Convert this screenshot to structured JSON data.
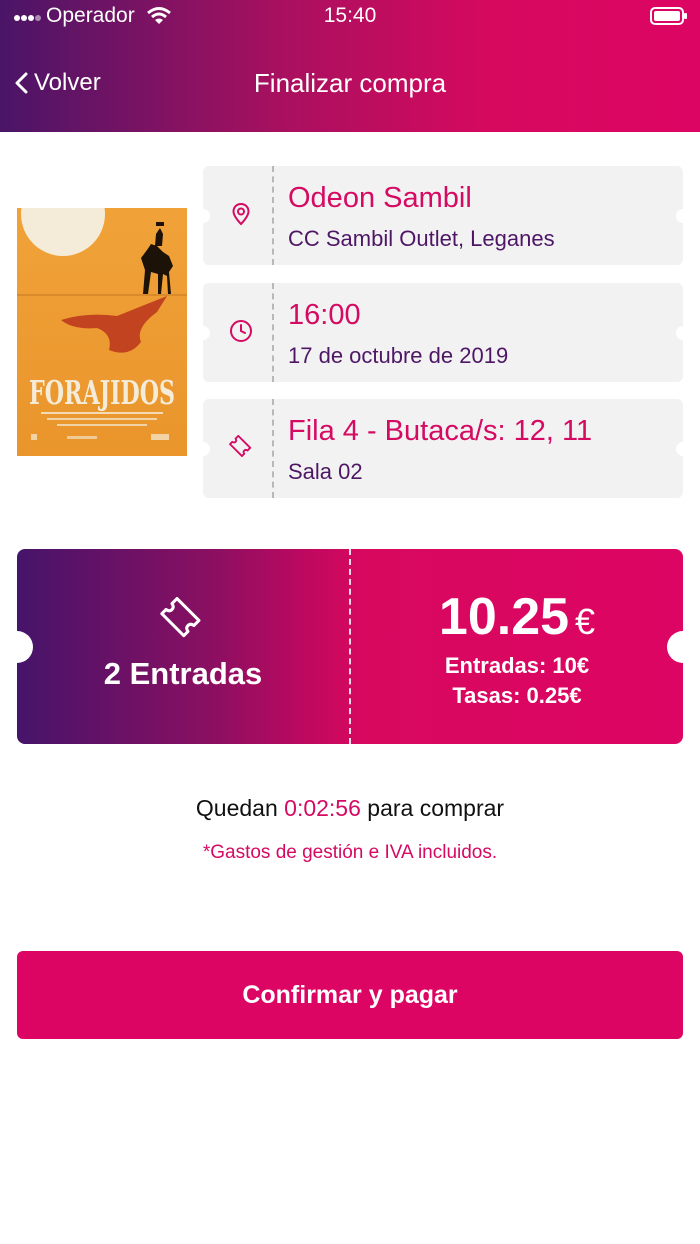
{
  "status_bar": {
    "carrier": "Operador",
    "time": "15:40"
  },
  "nav": {
    "back_label": "Volver",
    "title": "Finalizar compra"
  },
  "poster": {
    "title": "FORAJIDOS"
  },
  "cinema": {
    "name": "Odeon Sambil",
    "address": "CC Sambil Outlet, Leganes",
    "icon": "location-pin-icon"
  },
  "session": {
    "time": "16:00",
    "date": "17 de octubre de 2019",
    "icon": "clock-icon"
  },
  "seats": {
    "seats": "Fila 4 - Butaca/s: 12, 11",
    "room": "Sala 02",
    "icon": "ticket-icon"
  },
  "summary": {
    "tickets_count": "2 Entradas",
    "total": "10.25",
    "currency": "€",
    "tickets_price": "Entradas: 10€",
    "fees": "Tasas: 0.25€"
  },
  "timer": {
    "prefix": "Quedan",
    "time": "0:02:56",
    "suffix": "para comprar"
  },
  "note": "*Gastos de gestión e IVA incluidos.",
  "confirm_button": "Confirmar y pagar",
  "colors": {
    "accent": "#dd0563",
    "purple": "#4a1567",
    "card_bg": "#f2f2f2"
  }
}
